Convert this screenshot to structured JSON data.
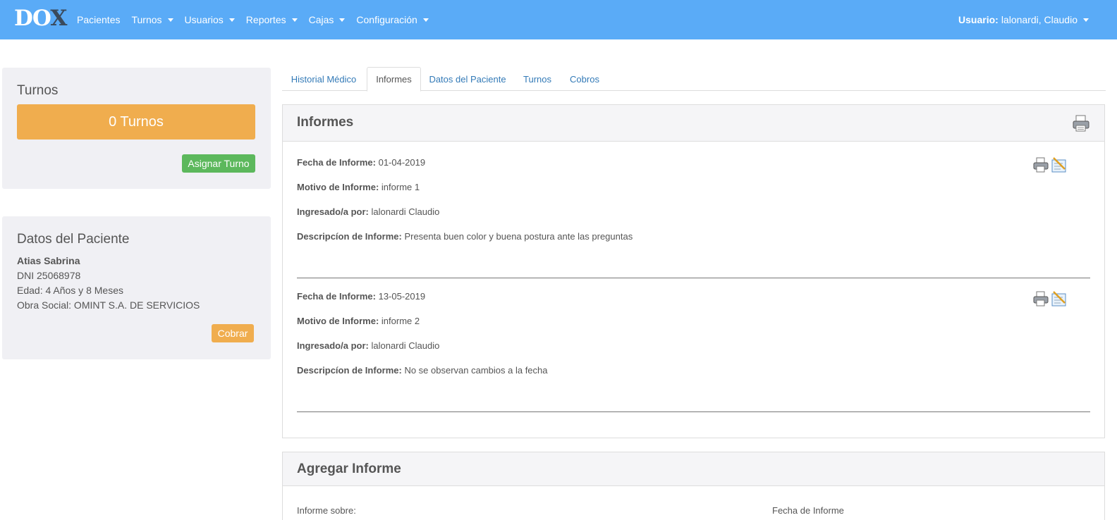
{
  "navbar": {
    "brand_a": "DO",
    "brand_b": "X",
    "menu": [
      {
        "label": "Pacientes"
      },
      {
        "label": "Turnos"
      },
      {
        "label": "Usuarios"
      },
      {
        "label": "Reportes"
      },
      {
        "label": "Cajas"
      },
      {
        "label": "Configuración"
      }
    ],
    "user_label": "Usuario:",
    "user_name": "lalonardi, Claudio"
  },
  "turnos_panel": {
    "title": "Turnos",
    "count": "0 Turnos",
    "assign_button": "Asignar Turno"
  },
  "patient_panel": {
    "title": "Datos del Paciente",
    "name": "Atias Sabrina",
    "dni": "DNI 25068978",
    "age": "Edad: 4 Años y 8 Meses",
    "insurance": "Obra Social: OMINT S.A. DE SERVICIOS",
    "charge_button": "Cobrar"
  },
  "tabs": [
    {
      "label": "Historial Médico"
    },
    {
      "label": "Informes"
    },
    {
      "label": "Datos del Paciente"
    },
    {
      "label": "Turnos"
    },
    {
      "label": "Cobros"
    }
  ],
  "informes": {
    "title": "Informes",
    "labels": {
      "fecha": "Fecha de Informe:",
      "motivo": "Motivo de Informe:",
      "ingresado": "Ingresado/a por:",
      "descripcion": "Descripcíon de Informe:"
    },
    "reports": [
      {
        "fecha": "01-04-2019",
        "motivo": "informe 1",
        "ingresado": "lalonardi Claudio",
        "descripcion": "Presenta buen color y buena postura ante las preguntas"
      },
      {
        "fecha": "13-05-2019",
        "motivo": "informe 2",
        "ingresado": "lalonardi Claudio",
        "descripcion": "No se observan cambios a la fecha"
      }
    ]
  },
  "agregar": {
    "title": "Agregar Informe",
    "field_sobre": "Informe sobre:",
    "field_fecha": "Fecha de Informe"
  },
  "colors": {
    "navbar": "#5aabf7",
    "warning": "#f0ad4e",
    "success": "#5cb85c",
    "link": "#337ab7"
  }
}
